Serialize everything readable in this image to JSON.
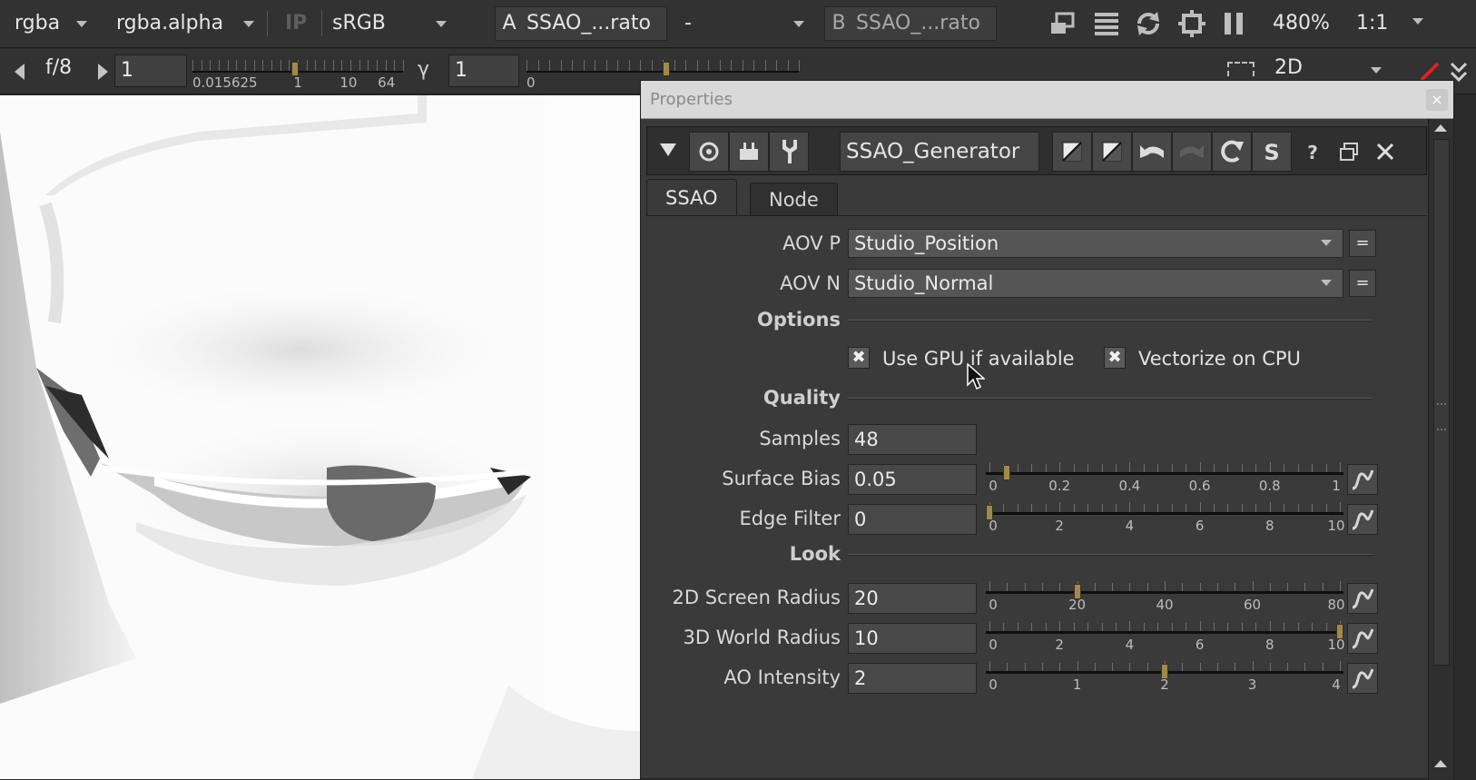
{
  "viewer_toolbar": {
    "channels": "rgba",
    "alpha_channel": "rgba.alpha",
    "ip_label": "IP",
    "colorspace": "sRGB",
    "input_a_label": "A",
    "input_a_value": "SSAO_...rato",
    "compare_mode": "-",
    "input_b_label": "B",
    "input_b_value": "SSAO_...rato",
    "zoom": "480%",
    "ratio": "1:1"
  },
  "viewer_toolbar2": {
    "fstop": "f/8",
    "gain_value": "1",
    "gain_ticks": [
      "0.015625",
      "1",
      "10",
      "64"
    ],
    "gamma_label": "γ",
    "gamma_value": "1",
    "gamma_tick": "0",
    "view_mode": "2D"
  },
  "properties": {
    "title": "Properties",
    "close_glyph": "×",
    "node_name": "SSAO_Generator",
    "tabs": [
      "SSAO",
      "Node"
    ],
    "aov_p_label": "AOV P",
    "aov_p_value": "Studio_Position",
    "aov_n_label": "AOV N",
    "aov_n_value": "Studio_Normal",
    "eq_glyph": "=",
    "sections": {
      "options": "Options",
      "quality": "Quality",
      "look": "Look"
    },
    "checks": [
      {
        "label": "Use GPU if available",
        "checked": true,
        "glyph": "✖"
      },
      {
        "label": "Vectorize on CPU",
        "checked": true,
        "glyph": "✖"
      }
    ],
    "params": [
      {
        "label": "Samples",
        "value": "48"
      },
      {
        "label": "Surface Bias",
        "value": "0.05",
        "ticks": [
          "0",
          "0.2",
          "0.4",
          "0.6",
          "0.8",
          "1"
        ],
        "fraction": 0.05
      },
      {
        "label": "Edge Filter",
        "value": "0",
        "ticks": [
          "0",
          "2",
          "4",
          "6",
          "8",
          "10"
        ],
        "fraction": 0.0
      },
      {
        "label": "2D Screen Radius",
        "value": "20",
        "ticks": [
          "0",
          "20",
          "40",
          "60",
          "80"
        ],
        "fraction": 0.25
      },
      {
        "label": "3D World Radius",
        "value": "10",
        "ticks": [
          "0",
          "2",
          "4",
          "6",
          "8",
          "10"
        ],
        "fraction": 1.0
      },
      {
        "label": "AO Intensity",
        "value": "2",
        "ticks": [
          "0",
          "1",
          "2",
          "3",
          "4"
        ],
        "fraction": 0.5
      }
    ]
  },
  "colors": {
    "accent_knob": "#a0894c",
    "panel_bg": "#3a3a3a",
    "viewer_bg": "#fafafa"
  }
}
